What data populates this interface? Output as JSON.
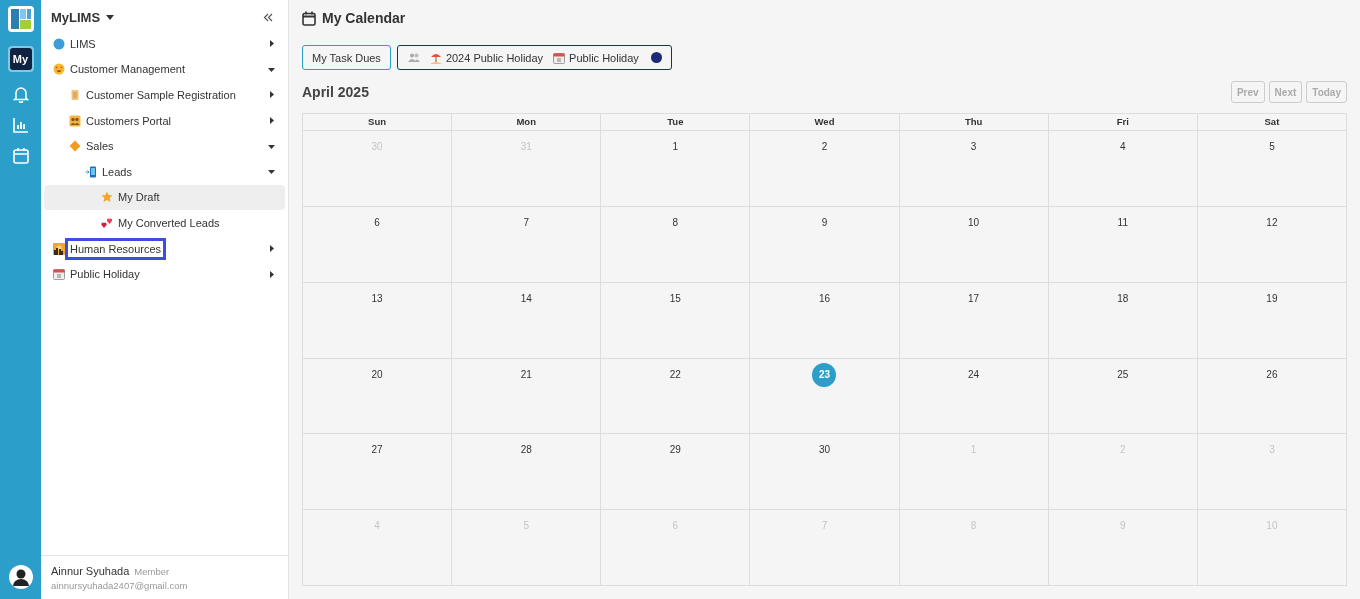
{
  "app": {
    "title": "MyLIMS",
    "rail_badge": "My"
  },
  "sidebar": {
    "items": [
      {
        "label": "LIMS",
        "expanded": false,
        "selected": false
      },
      {
        "label": "Customer Management",
        "expanded": true,
        "selected": false,
        "children": [
          {
            "label": "Customer Sample Registration",
            "expanded": false,
            "selected": false
          },
          {
            "label": "Customers Portal",
            "expanded": false,
            "selected": false
          },
          {
            "label": "Sales",
            "expanded": true,
            "selected": false,
            "children": [
              {
                "label": "Leads",
                "expanded": true,
                "selected": false,
                "children": [
                  {
                    "label": "My Draft",
                    "selected": true
                  },
                  {
                    "label": "My Converted Leads",
                    "selected": false
                  }
                ]
              }
            ]
          }
        ]
      },
      {
        "label": "Human Resources",
        "expanded": false,
        "selected": false,
        "highlight": true
      },
      {
        "label": "Public Holiday",
        "expanded": false,
        "selected": false
      }
    ]
  },
  "user": {
    "name": "Ainnur Syuhada",
    "role": "Member",
    "email": "ainnursyuhada2407@gmail.com"
  },
  "page": {
    "title": "My Calendar"
  },
  "filters": {
    "task_button": "My Task Dues",
    "legend": [
      "2024 Public Holiday",
      "Public Holiday"
    ],
    "color": "#1b2a7a"
  },
  "calendar": {
    "month": "April 2025",
    "nav": [
      "Prev",
      "Next",
      "Today"
    ],
    "weekdays": [
      "Sun",
      "Mon",
      "Tue",
      "Wed",
      "Thu",
      "Fri",
      "Sat"
    ],
    "weeks": [
      [
        {
          "day": "30",
          "muted": true,
          "today": false
        },
        {
          "day": "31",
          "muted": true,
          "today": false
        },
        {
          "day": "1",
          "muted": false,
          "today": false
        },
        {
          "day": "2",
          "muted": false,
          "today": false
        },
        {
          "day": "3",
          "muted": false,
          "today": false
        },
        {
          "day": "4",
          "muted": false,
          "today": false
        },
        {
          "day": "5",
          "muted": false,
          "today": false
        }
      ],
      [
        {
          "day": "6",
          "muted": false,
          "today": false
        },
        {
          "day": "7",
          "muted": false,
          "today": false
        },
        {
          "day": "8",
          "muted": false,
          "today": false
        },
        {
          "day": "9",
          "muted": false,
          "today": false
        },
        {
          "day": "10",
          "muted": false,
          "today": false
        },
        {
          "day": "11",
          "muted": false,
          "today": false
        },
        {
          "day": "12",
          "muted": false,
          "today": false
        }
      ],
      [
        {
          "day": "13",
          "muted": false,
          "today": false
        },
        {
          "day": "14",
          "muted": false,
          "today": false
        },
        {
          "day": "15",
          "muted": false,
          "today": false
        },
        {
          "day": "16",
          "muted": false,
          "today": false
        },
        {
          "day": "17",
          "muted": false,
          "today": false
        },
        {
          "day": "18",
          "muted": false,
          "today": false
        },
        {
          "day": "19",
          "muted": false,
          "today": false
        }
      ],
      [
        {
          "day": "20",
          "muted": false,
          "today": false
        },
        {
          "day": "21",
          "muted": false,
          "today": false
        },
        {
          "day": "22",
          "muted": false,
          "today": false
        },
        {
          "day": "23",
          "muted": false,
          "today": true
        },
        {
          "day": "24",
          "muted": false,
          "today": false
        },
        {
          "day": "25",
          "muted": false,
          "today": false
        },
        {
          "day": "26",
          "muted": false,
          "today": false
        }
      ],
      [
        {
          "day": "27",
          "muted": false,
          "today": false
        },
        {
          "day": "28",
          "muted": false,
          "today": false
        },
        {
          "day": "29",
          "muted": false,
          "today": false
        },
        {
          "day": "30",
          "muted": false,
          "today": false
        },
        {
          "day": "1",
          "muted": true,
          "today": false
        },
        {
          "day": "2",
          "muted": true,
          "today": false
        },
        {
          "day": "3",
          "muted": true,
          "today": false
        }
      ],
      [
        {
          "day": "4",
          "muted": true,
          "today": false
        },
        {
          "day": "5",
          "muted": true,
          "today": false
        },
        {
          "day": "6",
          "muted": true,
          "today": false
        },
        {
          "day": "7",
          "muted": true,
          "today": false
        },
        {
          "day": "8",
          "muted": true,
          "today": false
        },
        {
          "day": "9",
          "muted": true,
          "today": false
        },
        {
          "day": "10",
          "muted": true,
          "today": false
        }
      ]
    ]
  }
}
